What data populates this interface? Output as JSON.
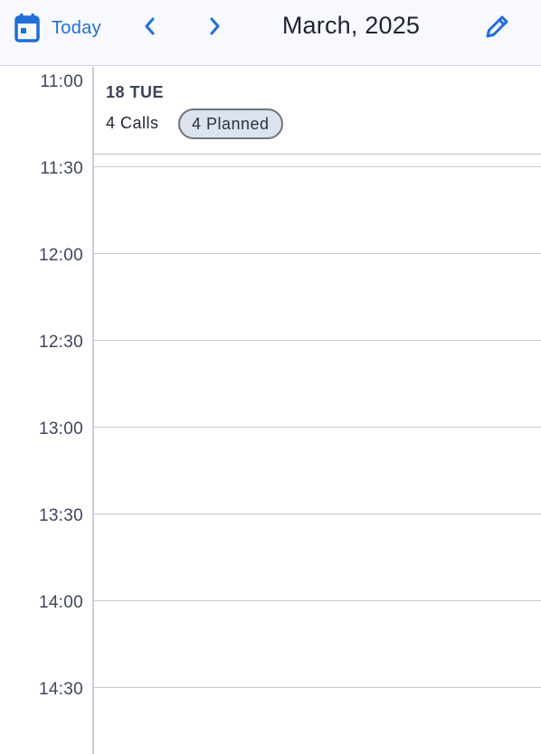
{
  "header": {
    "today_label": "Today",
    "month_title": "March, 2025",
    "icons": {
      "calendar": "calendar-icon",
      "prev": "chevron-left-icon",
      "next": "chevron-right-icon",
      "edit": "pencil-icon"
    },
    "accent_color": "#1f6fd6"
  },
  "day": {
    "title": "18 TUE",
    "calls_label": "4 Calls",
    "planned_label": "4 Planned"
  },
  "time_slots": [
    "11:00",
    "11:30",
    "12:00",
    "12:30",
    "13:00",
    "13:30",
    "14:00",
    "14:30"
  ]
}
